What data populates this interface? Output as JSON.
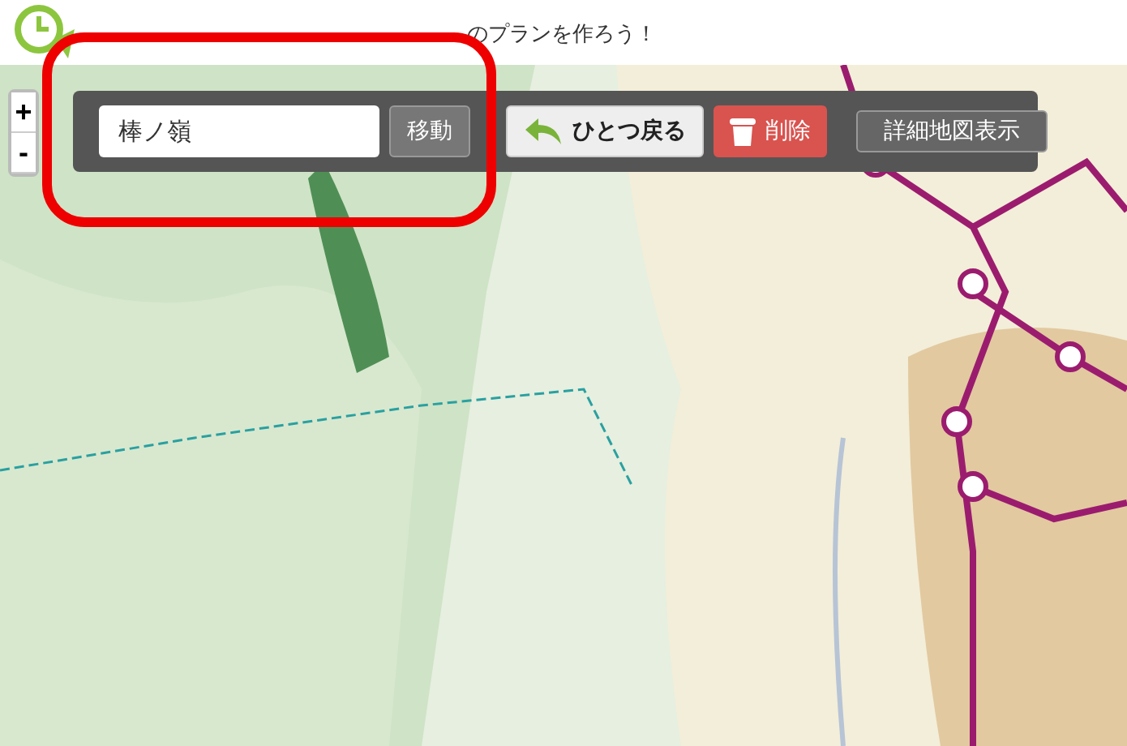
{
  "header": {
    "tagline": "のプランを作ろう！"
  },
  "zoom_controls": [
    "+",
    "-"
  ],
  "toolbar": {
    "search": {
      "value": "棒ノ嶺"
    },
    "buttons": [
      {
        "kind": "move",
        "label": "移動"
      },
      {
        "kind": "undo",
        "label": "ひとつ戻る"
      },
      {
        "kind": "delete",
        "label": "削除"
      },
      {
        "kind": "detail",
        "label": "詳細地図表示"
      }
    ]
  },
  "highlight": true
}
